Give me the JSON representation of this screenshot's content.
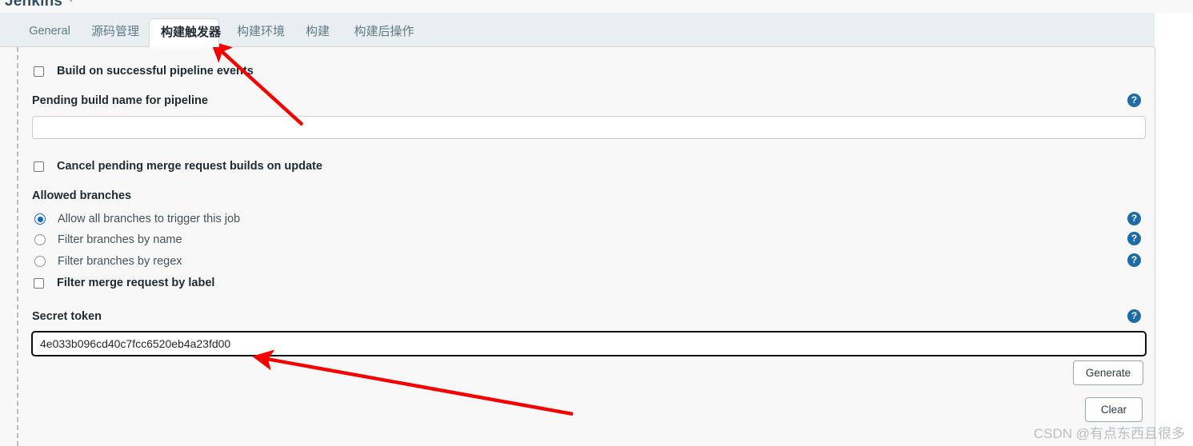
{
  "masthead": {
    "logo": "Jenkins",
    "caret_icon": "chevron-down-icon",
    "caret": "▾"
  },
  "tabs": [
    {
      "id": "general",
      "label": "General",
      "active": false
    },
    {
      "id": "scm",
      "label": "源码管理",
      "active": false
    },
    {
      "id": "triggers",
      "label": "构建触发器",
      "active": true
    },
    {
      "id": "buildenv",
      "label": "构建环境",
      "active": false
    },
    {
      "id": "build",
      "label": "构建",
      "active": false
    },
    {
      "id": "postbuild",
      "label": "构建后操作",
      "active": false
    }
  ],
  "form": {
    "ghost_row_text": "",
    "build_on_successful_pipeline_events": {
      "label": "Build on successful pipeline events",
      "checked": false
    },
    "pending_build_name": {
      "label": "Pending build name for pipeline",
      "value": "",
      "placeholder": "",
      "help_icon": "help-icon"
    },
    "cancel_pending_builds": {
      "label": "Cancel pending merge request builds on update",
      "checked": false
    },
    "allowed_branches": {
      "label": "Allowed branches",
      "options": [
        {
          "label": "Allow all branches to trigger this job",
          "type": "radio",
          "checked": true,
          "help_icon": "help-icon"
        },
        {
          "label": "Filter branches by name",
          "type": "radio",
          "checked": false,
          "help_icon": "help-icon"
        },
        {
          "label": "Filter branches by regex",
          "type": "radio",
          "checked": false,
          "help_icon": "help-icon"
        },
        {
          "label": "Filter merge request by label",
          "type": "checkbox",
          "checked": false,
          "help_icon": null
        }
      ]
    },
    "secret_token": {
      "label": "Secret token",
      "value": "4e033b096cd40c7fcc6520eb4a23fd00",
      "placeholder": "",
      "focused": true,
      "help_icon": "help-icon"
    },
    "buttons": {
      "generate": "Generate",
      "clear": "Clear"
    },
    "help_glyph": "?"
  },
  "annotations": {
    "arrow_color": "#f70000",
    "arrow_to_tab": "points at the 构建触发器 tab",
    "arrow_to_token": "points at the Secret token field"
  },
  "watermark": "CSDN @有点东西且很多"
}
